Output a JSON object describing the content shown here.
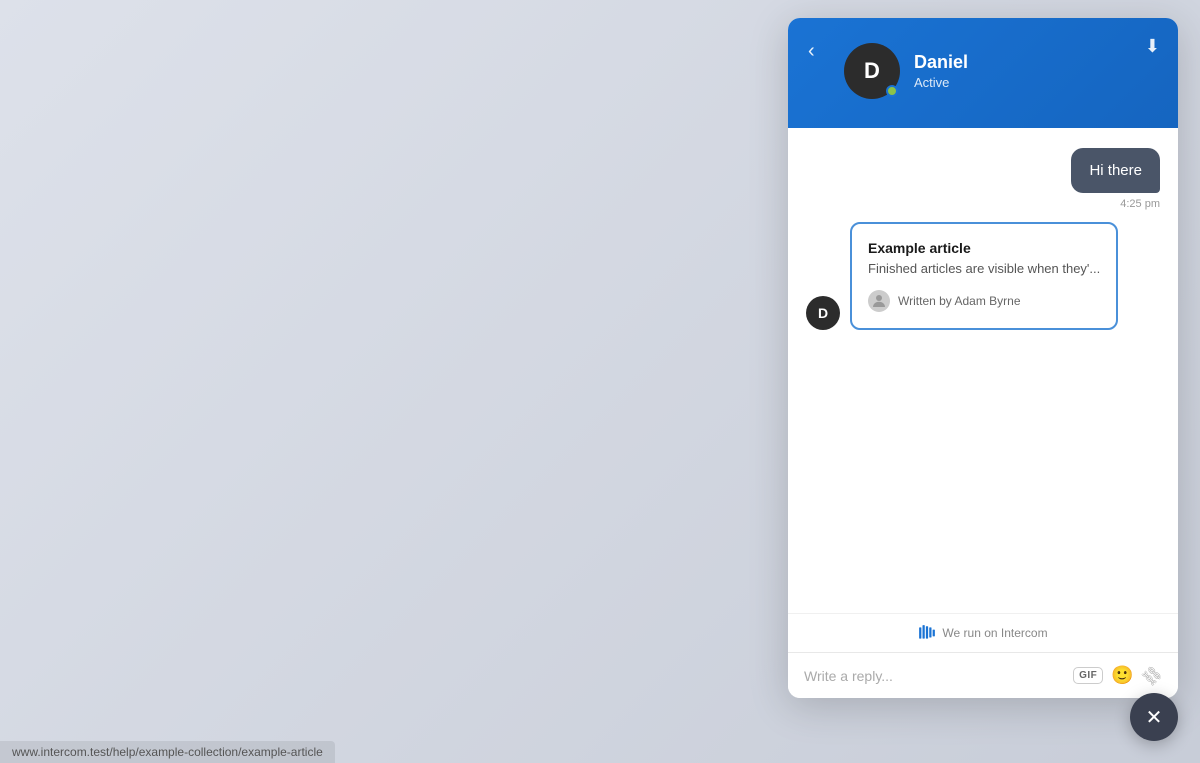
{
  "background": {
    "color": "#dde1ea"
  },
  "header": {
    "back_label": "‹",
    "download_label": "⬇",
    "agent_name": "Daniel",
    "agent_status": "Active",
    "avatar_initials": "D"
  },
  "messages": [
    {
      "type": "sent",
      "text": "Hi there",
      "time": "4:25 pm"
    }
  ],
  "article_card": {
    "title": "Example article",
    "excerpt": "Finished articles are visible when they'...",
    "author_label": "Written by Adam Byrne",
    "sender_initials": "D"
  },
  "powered_by": {
    "label": "We run on Intercom"
  },
  "reply_input": {
    "placeholder": "Write a reply..."
  },
  "toolbar": {
    "gif_label": "GIF",
    "emoji_label": "😊",
    "attach_label": "📎"
  },
  "close_button": {
    "label": "✕"
  },
  "status_bar": {
    "url": "www.intercom.test/help/example-collection/example-article"
  }
}
